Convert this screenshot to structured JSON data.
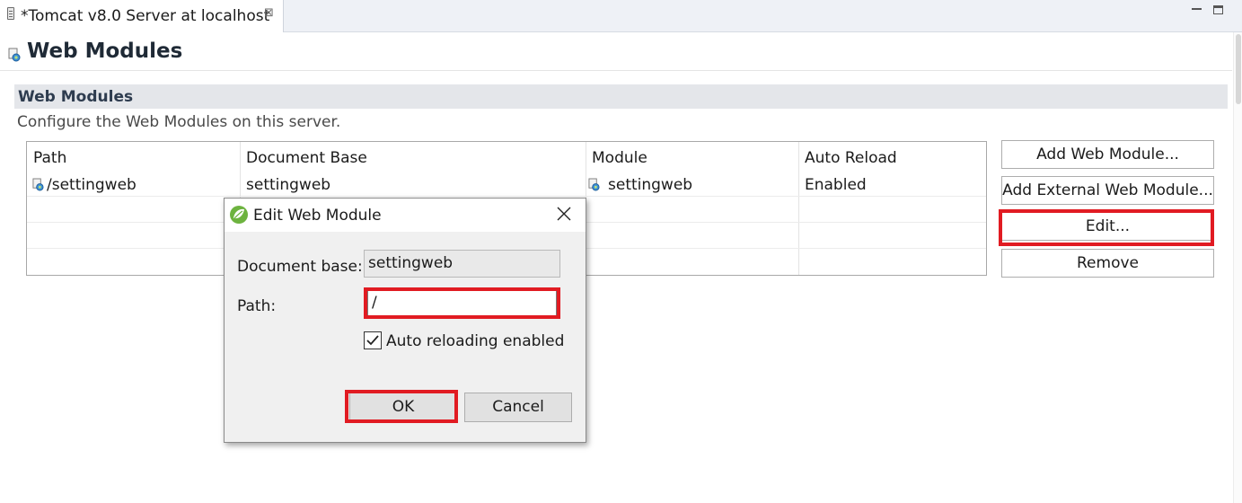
{
  "tab": {
    "title": "*Tomcat v8.0 Server at localhost",
    "close_glyph": "⊠"
  },
  "editor": {
    "title": "Web Modules"
  },
  "section": {
    "title": "Web Modules",
    "description": "Configure the Web Modules on this server."
  },
  "table": {
    "columns": [
      "Path",
      "Document Base",
      "Module",
      "Auto Reload"
    ],
    "rows": [
      {
        "path": "/settingweb",
        "document_base": "settingweb",
        "module": "settingweb",
        "auto_reload": "Enabled"
      }
    ]
  },
  "buttons": {
    "add": "Add Web Module...",
    "add_external": "Add External Web Module...",
    "edit": "Edit...",
    "remove": "Remove"
  },
  "dialog": {
    "title": "Edit Web Module",
    "document_base_label": "Document base:",
    "document_base_value": "settingweb",
    "path_label": "Path:",
    "path_value": "/",
    "auto_reload_label": "Auto reloading enabled",
    "auto_reload_checked": true,
    "ok_label": "OK",
    "cancel_label": "Cancel"
  },
  "colors": {
    "highlight": "#e11b22",
    "section_band": "#e4e6ea"
  }
}
